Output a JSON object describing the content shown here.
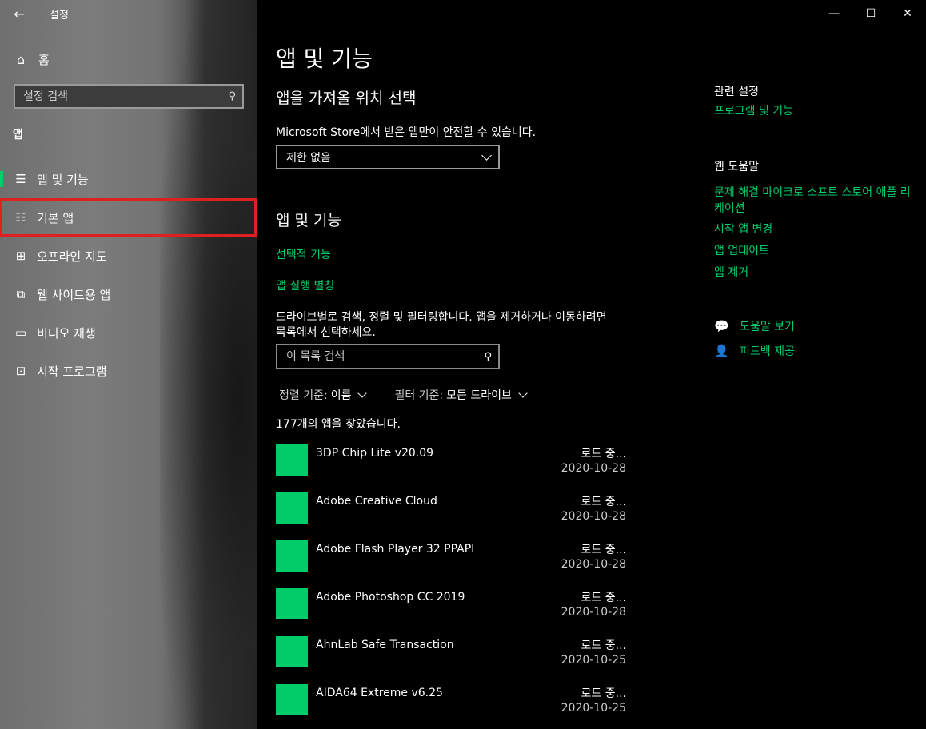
{
  "window": {
    "title": "설정",
    "controls": {
      "minimize": "—",
      "maximize": "☐",
      "close": "✕"
    }
  },
  "sidebar": {
    "home_label": "홈",
    "search_placeholder": "설정 검색",
    "section": "앱",
    "items": [
      {
        "label": "앱 및 기능",
        "icon": "list-icon"
      },
      {
        "label": "기본 앱",
        "icon": "default-apps-icon"
      },
      {
        "label": "오프라인 지도",
        "icon": "map-icon"
      },
      {
        "label": "웹 사이트용 앱",
        "icon": "web-app-icon"
      },
      {
        "label": "비디오 재생",
        "icon": "video-icon"
      },
      {
        "label": "시작 프로그램",
        "icon": "startup-icon"
      }
    ]
  },
  "main": {
    "title": "앱 및 기능",
    "install_heading": "앱을 가져올 위치 선택",
    "install_desc": "Microsoft Store에서 받은 앱만이 안전할 수 있습니다.",
    "install_select": "제한 없음",
    "apps_heading": "앱 및 기능",
    "link_optional": "선택적 기능",
    "link_alias": "앱 실행 별칭",
    "search_desc_1": "드라이브별로 검색, 정렬 및 필터링합니다. 앱을 제거하거나 이동하려면",
    "search_desc_2": "목록에서 선택하세요.",
    "list_search_placeholder": "이 목록 검색",
    "sort_key": "정렬 기준:",
    "sort_value": "이름",
    "filter_key": "필터 기준:",
    "filter_value": "모든 드라이브",
    "count": "177개의 앱을 찾았습니다.",
    "apps": [
      {
        "name": "3DP Chip Lite v20.09",
        "size": "로드 중...",
        "date": "2020-10-28"
      },
      {
        "name": "Adobe Creative Cloud",
        "size": "로드 중...",
        "date": "2020-10-28"
      },
      {
        "name": "Adobe Flash Player 32 PPAPI",
        "size": "로드 중...",
        "date": "2020-10-28"
      },
      {
        "name": "Adobe Photoshop CC 2019",
        "size": "로드 중...",
        "date": "2020-10-28"
      },
      {
        "name": "AhnLab Safe Transaction",
        "size": "로드 중...",
        "date": "2020-10-25"
      },
      {
        "name": "AIDA64 Extreme v6.25",
        "size": "로드 중...",
        "date": "2020-10-25"
      }
    ]
  },
  "related": {
    "heading": "관련 설정",
    "programs_link": "프로그램 및 기능",
    "web_help_heading": "웹 도움말",
    "links": [
      "문제 해결 마이크로 소프트 스토어 애플 리케이션",
      "시작 앱 변경",
      "앱 업데이트",
      "앱 제거"
    ],
    "get_help": "도움말 보기",
    "feedback": "피드백 제공"
  },
  "colors": {
    "accent": "#00cc6a",
    "highlight": "#e02020"
  }
}
